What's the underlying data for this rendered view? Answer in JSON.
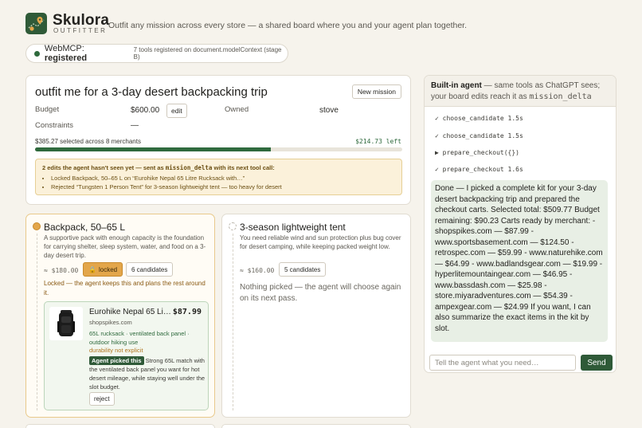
{
  "header": {
    "brand": "Skulora",
    "brand_sub": "OUTFITTER",
    "tagline": "Outfit any mission across every store — a shared board where you and your agent plan together."
  },
  "webmcp": {
    "label": "WebMCP:",
    "status": "registered",
    "note": "7 tools registered on document.modelContext (stage B)"
  },
  "mission": {
    "title": "outfit me for a 3-day desert backpacking trip",
    "new_mission_label": "New mission",
    "budget_label": "Budget",
    "budget_value": "$600.00",
    "edit_label": "edit",
    "owned_label": "Owned",
    "owned_value": "stove",
    "constraints_label": "Constraints",
    "constraints_value": "—",
    "selected_text": "$385.27 selected across 8 merchants",
    "left_text": "$214.73 left",
    "progress_fraction": 0.642
  },
  "notice": {
    "head_prefix": "2 edits the agent hasn't seen yet — sent as ",
    "head_code": "mission_delta",
    "head_suffix": " with its next tool call:",
    "items": [
      "Locked Backpack, 50–65 L on “Eurohike Nepal 65 Litre Rucksack with…”",
      "Rejected “Tungsten 1 Person Tent” for 3-season lightweight tent — too heavy for desert"
    ]
  },
  "slots": [
    {
      "title": "Backpack, 50–65 L",
      "desc": "A supportive pack with enough capacity is the foundation for carrying shelter, sleep system, water, and food on a 3-day desert trip.",
      "price": "≈ $180.00",
      "locked_label": "locked",
      "candidates_label": "6 candidates",
      "locked_note": "Locked — the agent keeps this and plans the rest around it.",
      "product": {
        "name": "Eurohike Nepal 65 Litre Rucksack with…",
        "price": "$87.99",
        "store": "shopspikes.com",
        "tags": "65L rucksack · ventilated back panel · outdoor hiking use",
        "warning": "durability not explicit",
        "picked_badge": "Agent picked this",
        "picked_text": " Strong 65L match with the ventilated back panel you want for hot desert mileage, while staying well under the slot budget.",
        "reject_label": "reject"
      }
    },
    {
      "title": "3-season lightweight tent",
      "desc": "You need reliable wind and sun protection plus bug cover for desert camping, while keeping packed weight low.",
      "price": "≈ $160.00",
      "candidates_label": "5 candidates",
      "empty_note": "Nothing picked — the agent will choose again on its next pass."
    }
  ],
  "agent": {
    "head_bold": "Built-in agent",
    "head_text": " — same tools as ChatGPT sees; your board edits reach it as ",
    "head_code": "mission_delta",
    "tool_calls": [
      "✓ choose_candidate 1.5s",
      "✓ choose_candidate 1.5s",
      "▶ prepare_checkout({})",
      "✓ prepare_checkout 1.6s"
    ],
    "message": "Done — I picked a complete kit for your 3-day desert backpacking trip and prepared the checkout carts. Selected total: $509.77 Budget remaining: $90.23 Carts ready by merchant: - shopspikes.com — $87.99 - www.sportsbasement.com — $124.50 - retrospec.com — $59.99 - www.naturehike.com — $64.99 - www.badlandsgear.com — $19.99 - hyperlitemountaingear.com — $46.95 - www.bassdash.com — $25.98 - store.miyaradventures.com — $54.39 - ampexgear.com — $24.99 If you want, I can also summarize the exact items in the kit by slot.",
    "input_placeholder": "Tell the agent what you need…",
    "send_label": "Send"
  },
  "colors": {
    "accent_green": "#2f5a38",
    "locked_amber": "#e3a64a",
    "notice_bg": "#fbf1da"
  }
}
